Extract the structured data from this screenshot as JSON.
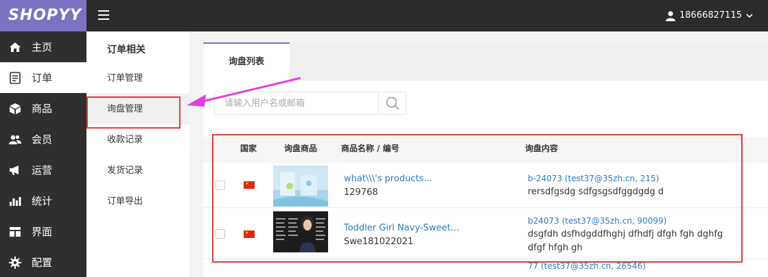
{
  "brand": "SHOPYY",
  "user": {
    "phone": "18666827115"
  },
  "sidebar": {
    "items": [
      {
        "label": "主页",
        "icon": "home-icon"
      },
      {
        "label": "订单",
        "icon": "order-icon"
      },
      {
        "label": "商品",
        "icon": "box-icon"
      },
      {
        "label": "会员",
        "icon": "users-icon"
      },
      {
        "label": "运营",
        "icon": "megaphone-icon"
      },
      {
        "label": "统计",
        "icon": "bar-chart-icon"
      },
      {
        "label": "界面",
        "icon": "layout-icon"
      },
      {
        "label": "配置",
        "icon": "gear-icon"
      }
    ]
  },
  "subnav": {
    "title": "订单相关",
    "items": [
      {
        "label": "订单管理"
      },
      {
        "label": "询盘管理"
      },
      {
        "label": "收款记录"
      },
      {
        "label": "发货记录"
      },
      {
        "label": "订单导出"
      }
    ]
  },
  "tabs": [
    {
      "label": "询盘列表"
    }
  ],
  "search": {
    "placeholder": "请输入用户名或邮箱"
  },
  "table": {
    "headers": {
      "country": "国家",
      "product": "询盘商品",
      "name_code": "商品名称 / 编号",
      "content": "询盘内容"
    },
    "rows": [
      {
        "name": "what\\\\\\'s products...",
        "code": "129768",
        "meta": "b-24073 (test37@35zh.cn, 215)",
        "message": "rersdfgsdg sdfgsgsdfggdgdg d"
      },
      {
        "name": "Toddler Girl Navy-Sweet...",
        "code": "Swe181022021",
        "meta": "b24073 (test37@35zh.cn, 90099)",
        "message": "dsgfdh dsfhdgddfhghj dfhdfj dfgh fgh dghfg dfgf hfgh gh"
      }
    ],
    "partial_row": {
      "meta": "77 (test37@35zh.cn, 26546)"
    }
  },
  "colors": {
    "brand": "#7b73c2",
    "topbar": "#2b2b2b",
    "sidebar": "#2f2f2f",
    "link": "#2d7bc2",
    "highlight": "#e23a3a",
    "arrow": "#e040e0"
  }
}
